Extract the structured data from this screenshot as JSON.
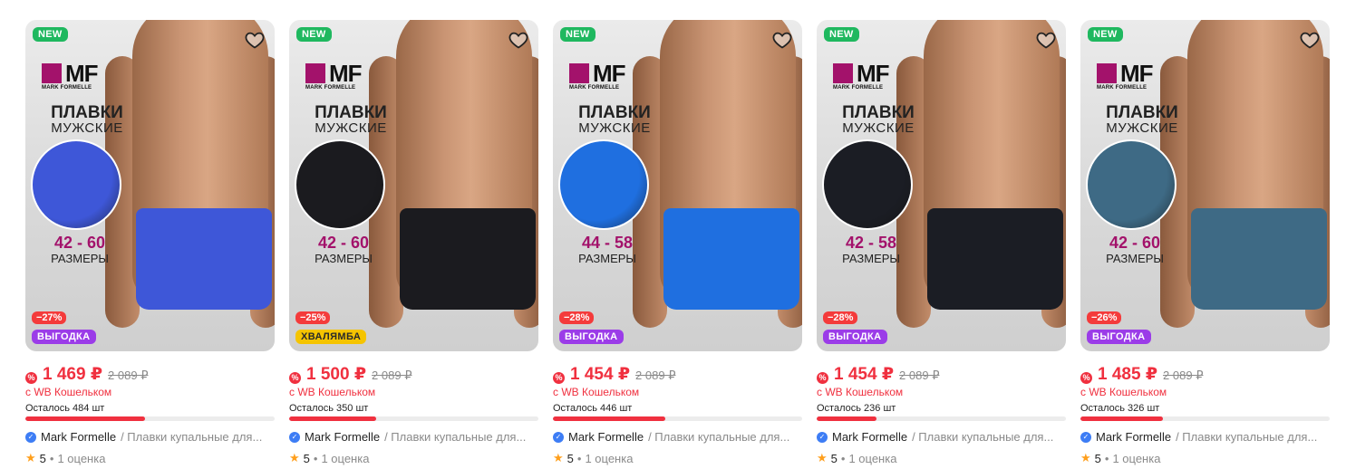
{
  "products": [
    {
      "badge_new": "NEW",
      "brand_logo": "MF",
      "brand_full": "MARK FORMELLE",
      "title_line1": "ПЛАВКИ",
      "title_line2": "МУЖСКИЕ",
      "sizes": "42 - 60",
      "sizes_label": "РАЗМЕРЫ",
      "discount": "−27%",
      "promo": "ВЫГОДКА",
      "promo_color": "#9b3ce8",
      "trunk_color": "#3e57d8",
      "price": "1 469 ₽",
      "old_price": "2 089 ₽",
      "wallet": "с WB Кошельком",
      "stock": "Осталось 484 шт",
      "stock_fill": 0.48,
      "brand": "Mark Formelle",
      "name": "/ Плавки купальные для...",
      "rating": "5",
      "reviews": "1 оценка"
    },
    {
      "badge_new": "NEW",
      "brand_logo": "MF",
      "brand_full": "MARK FORMELLE",
      "title_line1": "ПЛАВКИ",
      "title_line2": "МУЖСКИЕ",
      "sizes": "42 - 60",
      "sizes_label": "РАЗМЕРЫ",
      "discount": "−25%",
      "promo": "ХВАЛЯМБА",
      "promo_color": "#f5c400",
      "trunk_color": "#1b1b1f",
      "price": "1 500 ₽",
      "old_price": "2 089 ₽",
      "wallet": "с WB Кошельком",
      "stock": "Осталось 350 шт",
      "stock_fill": 0.35,
      "brand": "Mark Formelle",
      "name": "/ Плавки купальные для...",
      "rating": "5",
      "reviews": "1 оценка"
    },
    {
      "badge_new": "NEW",
      "brand_logo": "MF",
      "brand_full": "MARK FORMELLE",
      "title_line1": "ПЛАВКИ",
      "title_line2": "МУЖСКИЕ",
      "sizes": "44 - 58",
      "sizes_label": "РАЗМЕРЫ",
      "discount": "−28%",
      "promo": "ВЫГОДКА",
      "promo_color": "#9b3ce8",
      "trunk_color": "#1f6fe0",
      "price": "1 454 ₽",
      "old_price": "2 089 ₽",
      "wallet": "с WB Кошельком",
      "stock": "Осталось 446 шт",
      "stock_fill": 0.45,
      "brand": "Mark Formelle",
      "name": "/ Плавки купальные для...",
      "rating": "5",
      "reviews": "1 оценка"
    },
    {
      "badge_new": "NEW",
      "brand_logo": "MF",
      "brand_full": "MARK FORMELLE",
      "title_line1": "ПЛАВКИ",
      "title_line2": "МУЖСКИЕ",
      "sizes": "42 - 58",
      "sizes_label": "РАЗМЕРЫ",
      "discount": "−28%",
      "promo": "ВЫГОДКА",
      "promo_color": "#9b3ce8",
      "trunk_color": "#1b1d24",
      "price": "1 454 ₽",
      "old_price": "2 089 ₽",
      "wallet": "с WB Кошельком",
      "stock": "Осталось 236 шт",
      "stock_fill": 0.24,
      "brand": "Mark Formelle",
      "name": "/ Плавки купальные для...",
      "rating": "5",
      "reviews": "1 оценка"
    },
    {
      "badge_new": "NEW",
      "brand_logo": "MF",
      "brand_full": "MARK FORMELLE",
      "title_line1": "ПЛАВКИ",
      "title_line2": "МУЖСКИЕ",
      "sizes": "42 - 60",
      "sizes_label": "РАЗМЕРЫ",
      "discount": "−26%",
      "promo": "ВЫГОДКА",
      "promo_color": "#9b3ce8",
      "trunk_color": "#3e6a85",
      "price": "1 485 ₽",
      "old_price": "2 089 ₽",
      "wallet": "с WB Кошельком",
      "stock": "Осталось 326 шт",
      "stock_fill": 0.33,
      "brand": "Mark Formelle",
      "name": "/ Плавки купальные для...",
      "rating": "5",
      "reviews": "1 оценка"
    }
  ],
  "icons": {
    "favorite": "heart-icon",
    "wallet": "wallet-discount-icon",
    "verified": "verified-check-icon",
    "rating": "star-icon"
  }
}
